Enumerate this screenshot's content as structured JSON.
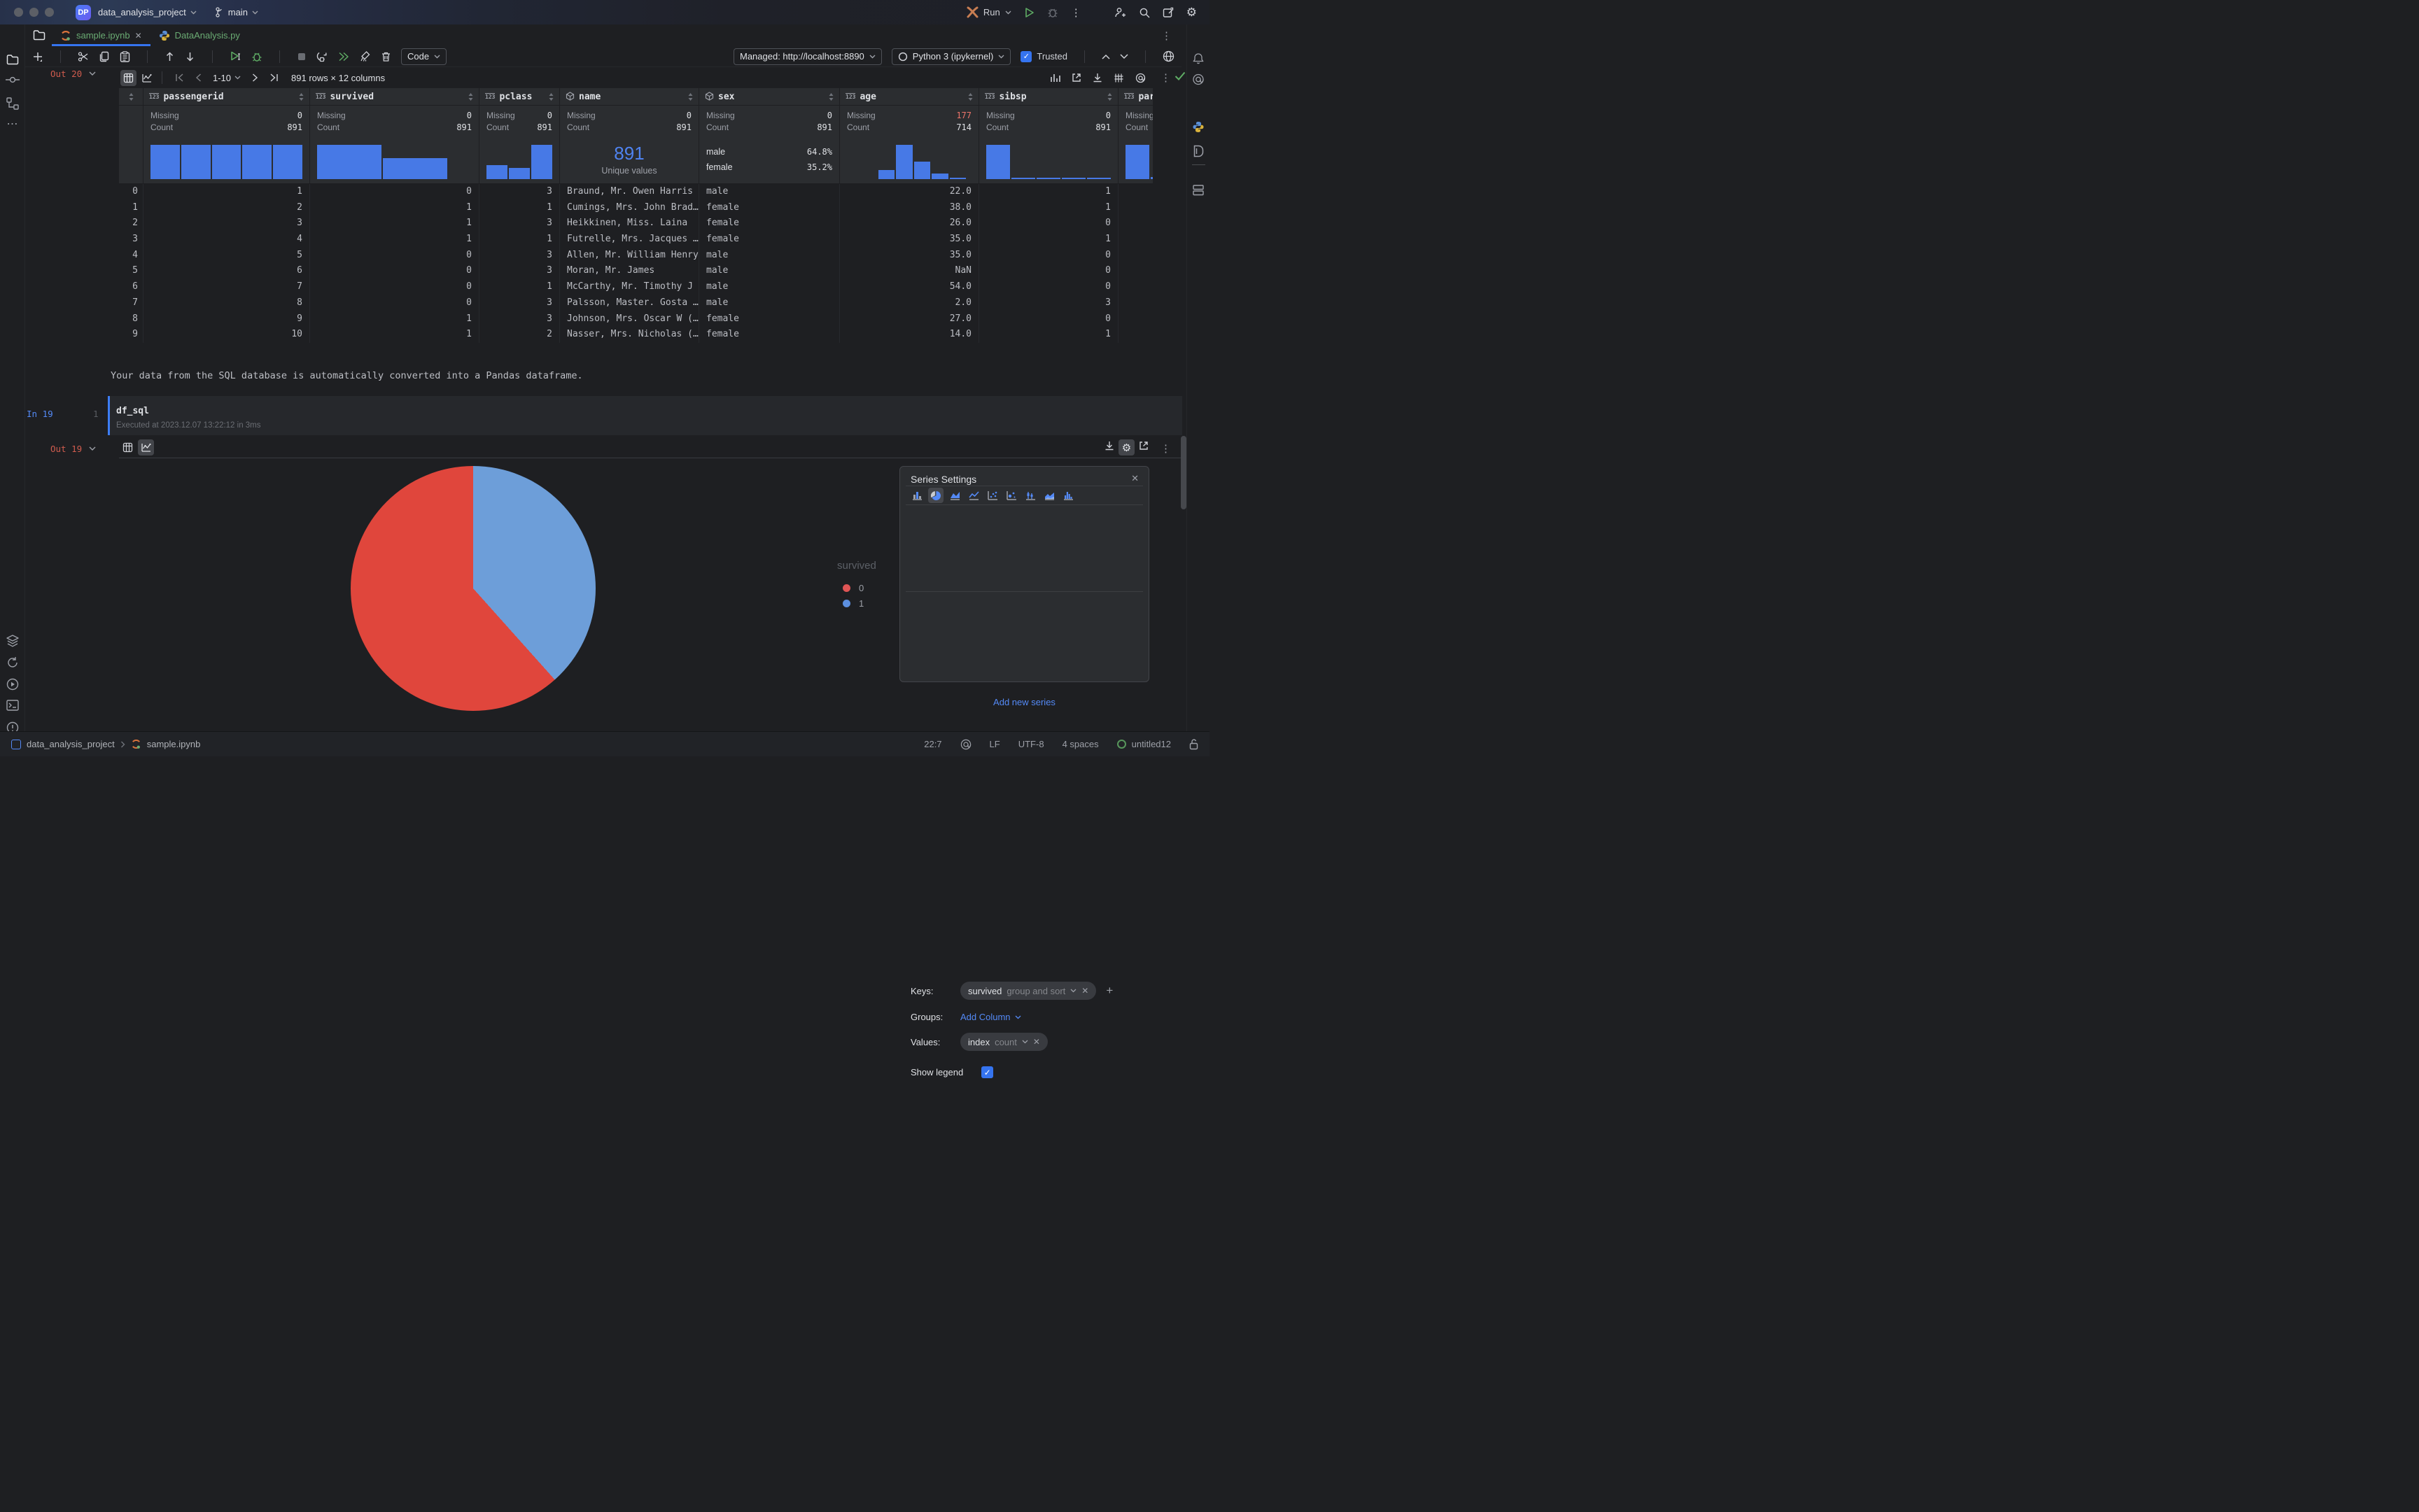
{
  "window": {
    "logo": "DP",
    "project": "data_analysis_project",
    "branch": "main",
    "run_label": "Run"
  },
  "tabs": [
    {
      "label": "sample.ipynb"
    },
    {
      "label": "DataAnalysis.py"
    }
  ],
  "toolbar": {
    "cell_type": "Code",
    "server": "Managed: http://localhost:8890",
    "kernel": "Python 3 (ipykernel)",
    "trusted_label": "Trusted"
  },
  "out20": {
    "label": "Out 20"
  },
  "grid": {
    "pagination": "1-10",
    "dims": "891 rows × 12 columns",
    "columns": [
      {
        "name": ""
      },
      {
        "name": "passengerid",
        "missing_label": "Missing",
        "count_label": "Count",
        "missing": "0",
        "count": "891",
        "hist": [
          100,
          100,
          100,
          100,
          100
        ]
      },
      {
        "name": "survived",
        "missing_label": "Missing",
        "count_label": "Count",
        "missing": "0",
        "count": "891",
        "hist": [
          100,
          62
        ]
      },
      {
        "name": "pclass",
        "missing_label": "Missing",
        "count_label": "Count",
        "missing": "0",
        "count": "891",
        "hist": [
          40,
          32,
          100
        ]
      },
      {
        "name": "name",
        "missing_label": "Missing",
        "count_label": "Count",
        "missing": "0",
        "count": "891",
        "unique_big": "891",
        "unique_label": "Unique values"
      },
      {
        "name": "sex",
        "missing_label": "Missing",
        "count_label": "Count",
        "missing": "0",
        "count": "891",
        "cats": [
          {
            "label": "male",
            "pct": "64.8%"
          },
          {
            "label": "female",
            "pct": "35.2%"
          }
        ]
      },
      {
        "name": "age",
        "missing_label": "Missing",
        "count_label": "Count",
        "missing": "177",
        "count": "714",
        "hist": [
          27,
          100,
          52,
          16,
          4
        ]
      },
      {
        "name": "sibsp",
        "missing_label": "Missing",
        "count_label": "Count",
        "missing": "0",
        "count": "891",
        "hist": [
          100,
          4,
          4,
          4,
          4
        ]
      },
      {
        "name": "parch",
        "missing_label": "Missing",
        "count_label": "Count",
        "hist": [
          100,
          6
        ]
      }
    ],
    "rows": [
      [
        "0",
        "1",
        "0",
        "3",
        "Braund, Mr. Owen Harris",
        "male",
        "22.0",
        "1",
        ""
      ],
      [
        "1",
        "2",
        "1",
        "1",
        "Cumings, Mrs. John Brad…",
        "female",
        "38.0",
        "1",
        ""
      ],
      [
        "2",
        "3",
        "1",
        "3",
        "Heikkinen, Miss. Laina",
        "female",
        "26.0",
        "0",
        ""
      ],
      [
        "3",
        "4",
        "1",
        "1",
        "Futrelle, Mrs. Jacques …",
        "female",
        "35.0",
        "1",
        ""
      ],
      [
        "4",
        "5",
        "0",
        "3",
        "Allen, Mr. William Henry",
        "male",
        "35.0",
        "0",
        ""
      ],
      [
        "5",
        "6",
        "0",
        "3",
        "Moran, Mr. James",
        "male",
        "NaN",
        "0",
        ""
      ],
      [
        "6",
        "7",
        "0",
        "1",
        "McCarthy, Mr. Timothy J",
        "male",
        "54.0",
        "0",
        ""
      ],
      [
        "7",
        "8",
        "0",
        "3",
        "Palsson, Master. Gosta …",
        "male",
        "2.0",
        "3",
        ""
      ],
      [
        "8",
        "9",
        "1",
        "3",
        "Johnson, Mrs. Oscar W (…",
        "female",
        "27.0",
        "0",
        ""
      ],
      [
        "9",
        "10",
        "1",
        "2",
        "Nasser, Mrs. Nicholas (…",
        "female",
        "14.0",
        "1",
        ""
      ]
    ]
  },
  "markdown": "Your data from the SQL database is automatically converted into a Pandas dataframe.",
  "in19": {
    "label": "In 19",
    "line_no": "1",
    "code": "df_sql",
    "executed": "Executed at 2023.12.07 13:22:12 in 3ms"
  },
  "out19": {
    "label": "Out 19"
  },
  "chart_data": {
    "type": "pie",
    "legend_title": "survived",
    "categories": [
      "0",
      "1"
    ],
    "values_pct": [
      61.6,
      38.4
    ],
    "colors": [
      "#e0463c",
      "#6d9ed9"
    ],
    "split_deg": 138.2,
    "legend_position": "right"
  },
  "legend": {
    "title": "survived",
    "items": [
      {
        "label": "0",
        "dot_style": "background:#e05555"
      },
      {
        "label": "1",
        "dot_style": "background:#5c8fe0"
      }
    ]
  },
  "series": {
    "title": "Series Settings",
    "keys_label": "Keys:",
    "keys_value": "survived",
    "keys_hint": "group and sort",
    "groups_label": "Groups:",
    "groups_value": "Add Column",
    "values_label": "Values:",
    "values_value": "index",
    "values_hint": "count",
    "show_legend_label": "Show legend",
    "add_new": "Add new series"
  },
  "status": {
    "project": "data_analysis_project",
    "file": "sample.ipynb",
    "caret": "22:7",
    "line_ending": "LF",
    "encoding": "UTF-8",
    "indent": "4 spaces",
    "env": "untitled12"
  }
}
